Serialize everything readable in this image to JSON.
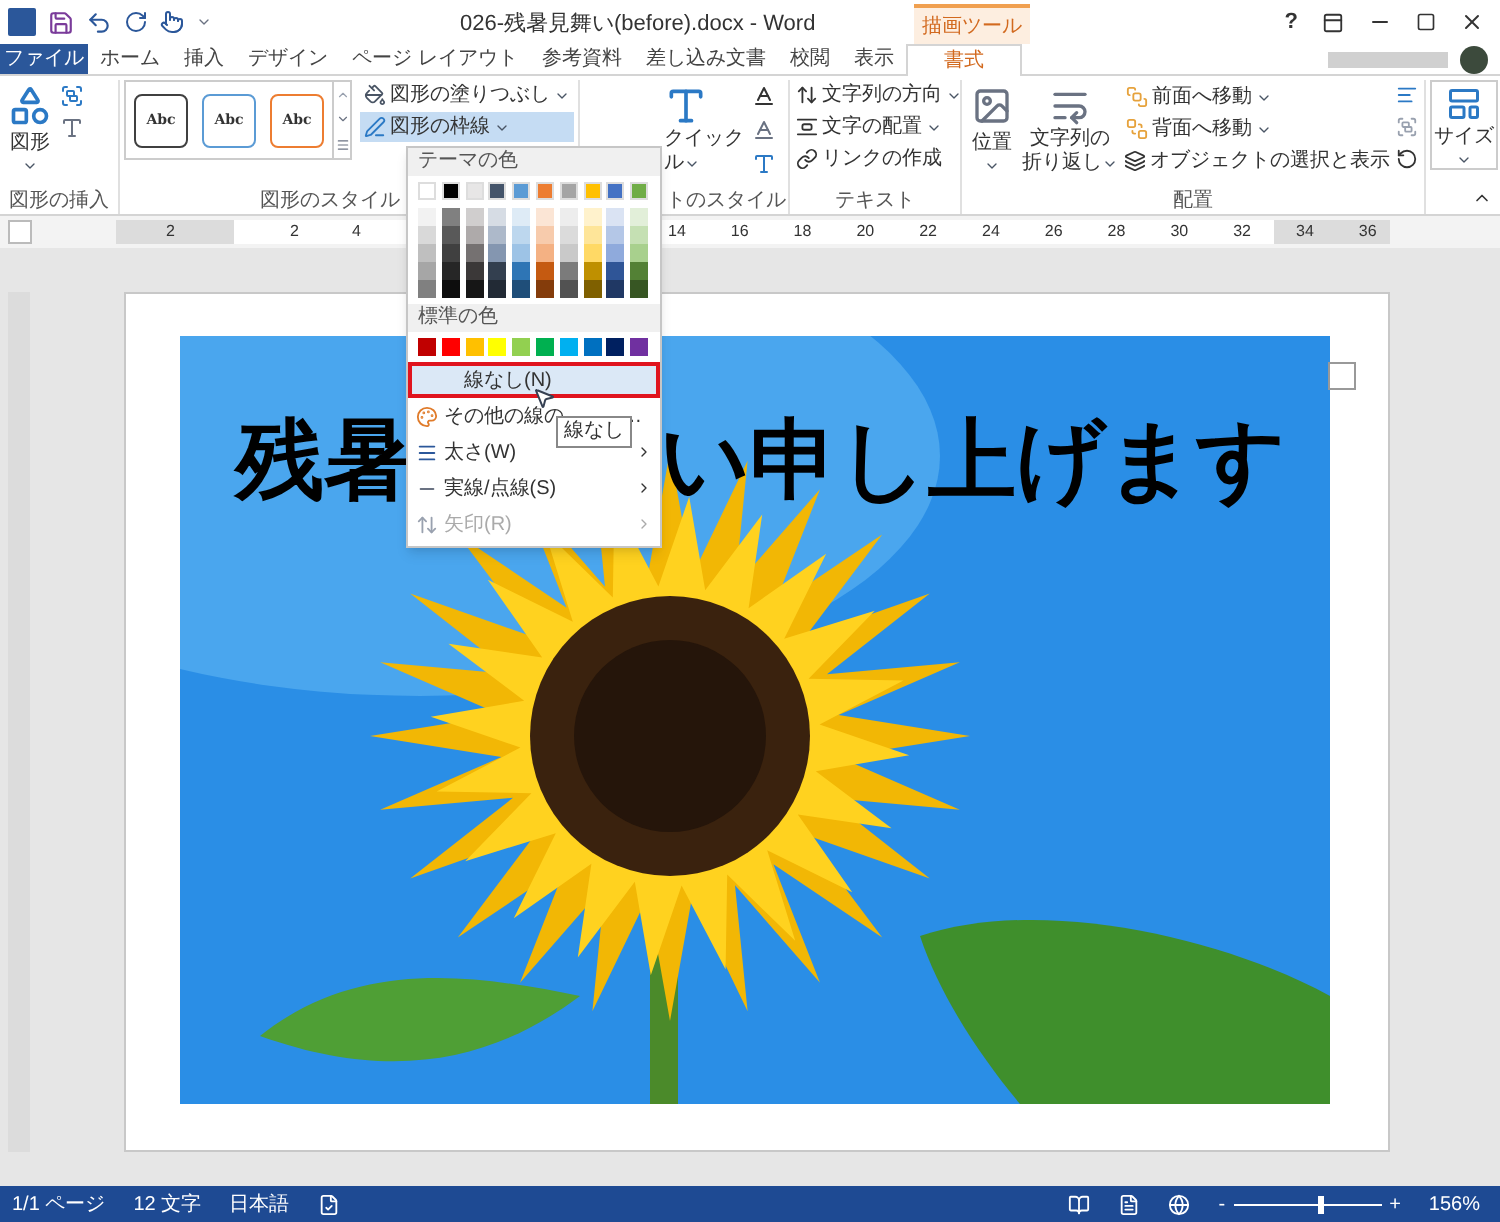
{
  "title_bar": {
    "title": "026-残暑見舞い(before).docx - Word",
    "context_label": "描画ツール",
    "help": "?"
  },
  "tabs": [
    {
      "label": "ファイル",
      "kind": "file",
      "selected": false
    },
    {
      "label": "ホーム",
      "kind": "tab",
      "selected": false
    },
    {
      "label": "挿入",
      "kind": "tab",
      "selected": false
    },
    {
      "label": "デザイン",
      "kind": "tab",
      "selected": false
    },
    {
      "label": "ページ レイアウト",
      "kind": "tab",
      "selected": false
    },
    {
      "label": "参考資料",
      "kind": "tab",
      "selected": false
    },
    {
      "label": "差し込み文書",
      "kind": "tab",
      "selected": false
    },
    {
      "label": "校閲",
      "kind": "tab",
      "selected": false
    },
    {
      "label": "表示",
      "kind": "tab",
      "selected": false
    },
    {
      "label": "書式",
      "kind": "tab",
      "selected": true
    }
  ],
  "ribbon": {
    "insert_shapes": {
      "shapes_button": "図形",
      "label": "図形の挿入"
    },
    "shape_styles": {
      "gallery": [
        {
          "label": "Abc",
          "color": "#404040"
        },
        {
          "label": "Abc",
          "color": "#5b9bd5"
        },
        {
          "label": "Abc",
          "color": "#ed7d31"
        }
      ],
      "fill_button": "図形の塗りつぶし",
      "outline_button": {
        "label": "図形の枠線",
        "selected": true
      },
      "label": "図形のスタイル"
    },
    "wordart_styles": {
      "quick_styles_top": "クイック",
      "quick_styles_bottom": "ル",
      "label": "トのスタイル"
    },
    "text": {
      "buttons": [
        "文字列の方向",
        "文字の配置",
        "リンクの作成"
      ],
      "label": "テキスト"
    },
    "arrange": {
      "position_button": "位置",
      "wrap_button": [
        "文字列の",
        "折り返し"
      ],
      "buttons": [
        "前面へ移動",
        "背面へ移動",
        "オブジェクトの選択と表示"
      ],
      "label": "配置"
    },
    "size": {
      "button": "サイズ"
    }
  },
  "ruler": {
    "left_labels": [
      "2",
      "2",
      "4"
    ],
    "right_labels": [
      "14",
      "16",
      "18",
      "20",
      "22",
      "24",
      "26",
      "28",
      "30",
      "32",
      "34",
      "36"
    ]
  },
  "document": {
    "heading_parts": [
      "残暑",
      "い申し上げます"
    ]
  },
  "outline_menu": {
    "theme_header": "テーマの色",
    "theme_colors": [
      {
        "color": "#ffffff",
        "shades": [
          {
            "color": "#f2f2f2"
          },
          {
            "color": "#d9d9d9"
          },
          {
            "color": "#bfbfbf"
          },
          {
            "color": "#a6a6a6"
          },
          {
            "color": "#808080"
          }
        ]
      },
      {
        "color": "#000000",
        "shades": [
          {
            "color": "#808080"
          },
          {
            "color": "#595959"
          },
          {
            "color": "#404040"
          },
          {
            "color": "#262626"
          },
          {
            "color": "#0d0d0d"
          }
        ]
      },
      {
        "color": "#e7e6e6",
        "shades": [
          {
            "color": "#d0cece"
          },
          {
            "color": "#aeaaaa"
          },
          {
            "color": "#757171"
          },
          {
            "color": "#3b3838"
          },
          {
            "color": "#161616"
          }
        ]
      },
      {
        "color": "#44546a",
        "shades": [
          {
            "color": "#d6dce4"
          },
          {
            "color": "#adb9ca"
          },
          {
            "color": "#8496b0"
          },
          {
            "color": "#333f4f"
          },
          {
            "color": "#222a35"
          }
        ]
      },
      {
        "color": "#5b9bd5",
        "shades": [
          {
            "color": "#deebf6"
          },
          {
            "color": "#bdd7ee"
          },
          {
            "color": "#9dc3e6"
          },
          {
            "color": "#2e75b5"
          },
          {
            "color": "#1f4e79"
          }
        ]
      },
      {
        "color": "#ed7d31",
        "shades": [
          {
            "color": "#fbe5d5"
          },
          {
            "color": "#f7cbac"
          },
          {
            "color": "#f4b183"
          },
          {
            "color": "#c55a11"
          },
          {
            "color": "#843c0b"
          }
        ]
      },
      {
        "color": "#a5a5a5",
        "shades": [
          {
            "color": "#ededed"
          },
          {
            "color": "#dbdbdb"
          },
          {
            "color": "#c9c9c9"
          },
          {
            "color": "#7b7b7b"
          },
          {
            "color": "#525252"
          }
        ]
      },
      {
        "color": "#ffc000",
        "shades": [
          {
            "color": "#fff2cc"
          },
          {
            "color": "#fee599"
          },
          {
            "color": "#ffd965"
          },
          {
            "color": "#bf9000"
          },
          {
            "color": "#7f6000"
          }
        ]
      },
      {
        "color": "#4472c4",
        "shades": [
          {
            "color": "#dae3f3"
          },
          {
            "color": "#b4c7e7"
          },
          {
            "color": "#8faadc"
          },
          {
            "color": "#2f5597"
          },
          {
            "color": "#203864"
          }
        ]
      },
      {
        "color": "#70ad47",
        "shades": [
          {
            "color": "#e2efd9"
          },
          {
            "color": "#c5e0b3"
          },
          {
            "color": "#a8d08d"
          },
          {
            "color": "#538135"
          },
          {
            "color": "#375623"
          }
        ]
      }
    ],
    "standard_header": "標準の色",
    "standard_colors": [
      {
        "color": "#c00000"
      },
      {
        "color": "#ff0000"
      },
      {
        "color": "#ffc000"
      },
      {
        "color": "#ffff00"
      },
      {
        "color": "#92d050"
      },
      {
        "color": "#00b050"
      },
      {
        "color": "#00b0f0"
      },
      {
        "color": "#0070c0"
      },
      {
        "color": "#002060"
      },
      {
        "color": "#7030a0"
      }
    ],
    "items": [
      {
        "kind": "no_line",
        "label": "線なし(N)",
        "selected": true,
        "disabled": false,
        "submenu": false
      },
      {
        "kind": "more_colors",
        "label": "その他の線の",
        "trailing": "…",
        "selected": false,
        "disabled": false,
        "submenu": false
      },
      {
        "kind": "weight",
        "label": "太さ(W)",
        "selected": false,
        "disabled": false,
        "submenu": true
      },
      {
        "kind": "dashes",
        "label": "実線/点線(S)",
        "selected": false,
        "disabled": false,
        "submenu": true
      },
      {
        "kind": "arrows",
        "label": "矢印(R)",
        "selected": false,
        "disabled": true,
        "submenu": true
      }
    ]
  },
  "tooltip": "線なし",
  "status_bar": {
    "page": "1/1 ページ",
    "words": "12 文字",
    "language": "日本語",
    "zoom_minus": "-",
    "zoom_plus": "+",
    "zoom_slider": {
      "level": 0.58
    },
    "zoom": "156%"
  }
}
